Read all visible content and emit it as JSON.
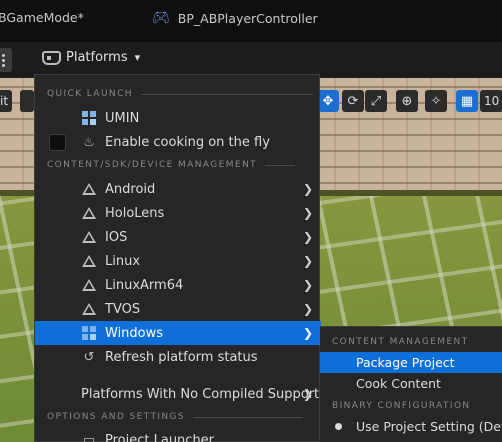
{
  "tabs": [
    {
      "label": "BGameMode*"
    },
    {
      "label": "BP_ABPlayerController"
    }
  ],
  "toolbar": {
    "platforms_label": "Platforms"
  },
  "viewport": {
    "left_button": "it",
    "grid_value": "10"
  },
  "menu": {
    "sections": {
      "quick_launch": "QUICK LAUNCH",
      "content_sdk": "CONTENT/SDK/DEVICE MANAGEMENT",
      "options": "OPTIONS AND SETTINGS"
    },
    "items": {
      "umin": "UMIN",
      "cooking": "Enable cooking on the fly",
      "android": "Android",
      "hololens": "HoloLens",
      "ios": "IOS",
      "linux": "Linux",
      "linuxarm64": "LinuxArm64",
      "tvos": "TVOS",
      "windows": "Windows",
      "refresh": "Refresh platform status",
      "no_compiled": "Platforms With No Compiled Support",
      "project_launcher": "Project Launcher"
    }
  },
  "submenu": {
    "section_content": "CONTENT MANAGEMENT",
    "section_binary": "BINARY CONFIGURATION",
    "package_project": "Package Project",
    "cook_content": "Cook Content",
    "use_project_setting": "Use Project Setting (Deve"
  },
  "colors": {
    "accent": "#0f6fd8",
    "menu_bg": "#262626"
  }
}
